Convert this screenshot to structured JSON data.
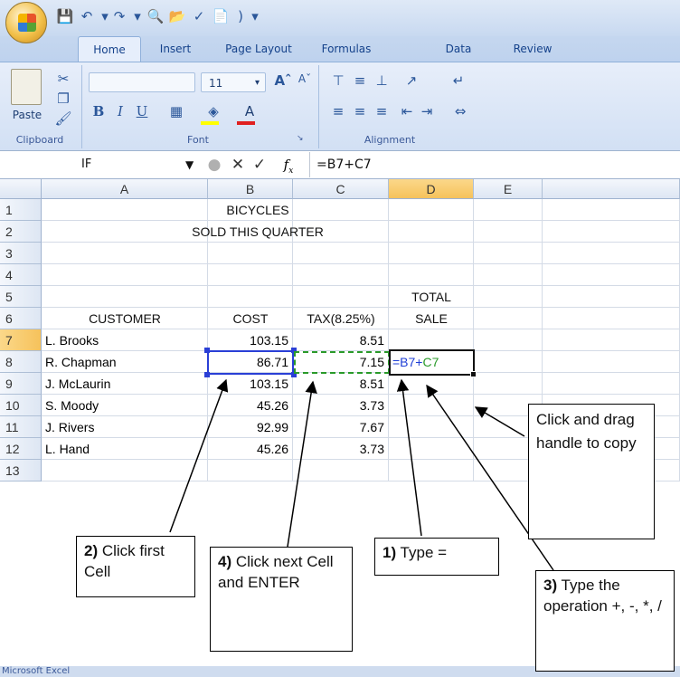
{
  "tabs": [
    "Home",
    "Insert",
    "Page Layout",
    "Formulas",
    "Data",
    "Review"
  ],
  "groups": {
    "clipboard": "Clipboard",
    "font": "Font",
    "alignment": "Alignment"
  },
  "clipboard": {
    "paste": "Paste"
  },
  "font": {
    "size": "11",
    "bold": "B",
    "italic": "I",
    "underline": "U"
  },
  "name_box": "IF",
  "formula": "=B7+C7",
  "columns": [
    "A",
    "B",
    "C",
    "D",
    "E"
  ],
  "rows": [
    "1",
    "2",
    "3",
    "4",
    "5",
    "6",
    "7",
    "8",
    "9",
    "10",
    "11",
    "12",
    "13"
  ],
  "sheet": {
    "title1": "BICYCLES",
    "title2": "SOLD THIS QUARTER",
    "header_total": "TOTAL",
    "header_customer": "CUSTOMER",
    "header_cost": "COST",
    "header_tax": "TAX(8.25%)",
    "header_sale": "SALE",
    "data": [
      {
        "customer": "L. Brooks",
        "cost": "103.15",
        "tax": "8.51"
      },
      {
        "customer": "R. Chapman",
        "cost": "86.71",
        "tax": "7.15"
      },
      {
        "customer": "J. McLaurin",
        "cost": "103.15",
        "tax": "8.51"
      },
      {
        "customer": "S. Moody",
        "cost": "45.26",
        "tax": "3.73"
      },
      {
        "customer": "J. Rivers",
        "cost": "92.99",
        "tax": "7.67"
      },
      {
        "customer": "L. Hand",
        "cost": "45.26",
        "tax": "3.73"
      }
    ],
    "edit_prefix": "=B7+",
    "edit_ref": "C7"
  },
  "callouts": {
    "c1_bold": "1)",
    "c1_text": " Type =",
    "c2_bold": "2)",
    "c2_text": " Click first Cell",
    "c3_bold": "3)",
    "c3_text": " Type the operation +, -, *, /",
    "c4_bold": "4)",
    "c4_text": " Click next Cell and ENTER",
    "c5_text": "Click and drag handle to copy"
  },
  "status": "Microsoft Excel",
  "colors": {
    "ribbon": "#dbe6f6",
    "selected_header": "#f6c25b",
    "ref_blue": "#1f3fd6",
    "ref_green": "#2a9a2a"
  }
}
